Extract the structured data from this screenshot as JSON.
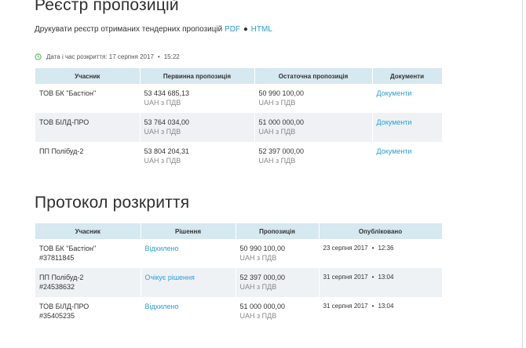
{
  "registry": {
    "title": "Реєстр пропозицій",
    "print_text": "Друкувати реєстр отриманих тендерних пропозицій",
    "pdf_link": "PDF",
    "bullet": "●",
    "html_link": "HTML",
    "open_date_label": "Дата і час розкриття: 17 серпня 2017",
    "open_time": "15:22",
    "columns": [
      "Учасник",
      "Первинна пропозиція",
      "Остаточна пропозиція",
      "Документи"
    ],
    "rows": [
      {
        "participant": "ТОВ БК \"Бастіон\"",
        "initial": "53 434 685,13",
        "initial_vat": "UAH з ПДВ",
        "final": "50 990 100,00",
        "final_vat": "UAH з ПДВ",
        "docs": "Документи"
      },
      {
        "participant": "ТОВ БІЛД-ПРО",
        "initial": "53 764 034,00",
        "initial_vat": "UAH з ПДВ",
        "final": "51 000 000,00",
        "final_vat": "UAH з ПДВ",
        "docs": "Документи"
      },
      {
        "participant": "ПП Полібуд-2",
        "initial": "53 804 204,31",
        "initial_vat": "UAH з ПДВ",
        "final": "52 397 000,00",
        "final_vat": "UAH з ПДВ",
        "docs": "Документи"
      }
    ]
  },
  "protocol": {
    "title": "Протокол розкриття",
    "columns": [
      "Учасник",
      "Рішення",
      "Пропозиція",
      "Опубліковано"
    ],
    "rows": [
      {
        "participant": "ТОВ БК \"Бастіон\"",
        "code": "#37811845",
        "decision": "Відхилено",
        "offer": "50 990 100,00",
        "offer_vat": "UAH з ПДВ",
        "date": "23 серпня 2017",
        "time": "12:36"
      },
      {
        "participant": "ПП Полібуд-2",
        "code": "#24538632",
        "decision": "Очікує рішення",
        "offer": "52 397 000,00",
        "offer_vat": "UAH з ПДВ",
        "date": "31 серпня 2017",
        "time": "13:04"
      },
      {
        "participant": "ТОВ БІЛД-ПРО",
        "code": "#35405235",
        "decision": "Відхилено",
        "offer": "51 000 000,00",
        "offer_vat": "UAH з ПДВ",
        "date": "31 серпня 2017",
        "time": "13:04"
      }
    ]
  },
  "colors": {
    "accent": "#2a9fd6",
    "header_bg": "#d6e8f0",
    "row_shade": "#eef2f4",
    "clock": "#5cb85c"
  },
  "icons": {
    "open_date": "clock-icon"
  }
}
